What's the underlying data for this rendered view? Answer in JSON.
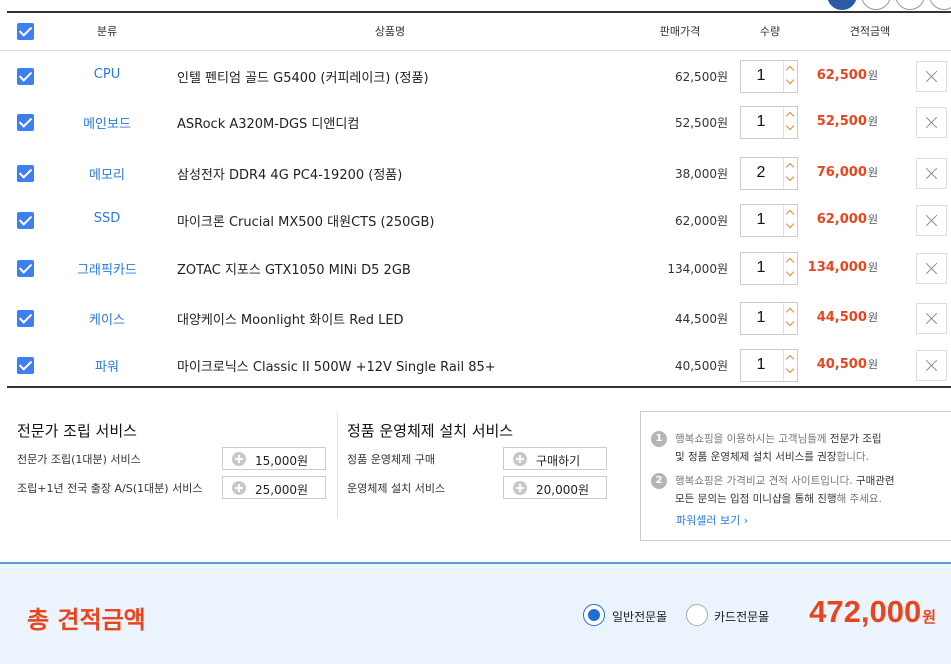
{
  "header": {
    "category": "분류",
    "product": "상품명",
    "price": "판매가격",
    "quantity": "수량",
    "estimate": "견적금액"
  },
  "items": [
    {
      "category": "CPU",
      "product": "인텔 펜티엄 골드 G5400 (커피레이크) (정품)",
      "price": "62,500원",
      "qty": "1",
      "total": "62,500",
      "won": "원"
    },
    {
      "category": "메인보드",
      "product": "ASRock A320M-DGS 디앤디컴",
      "price": "52,500원",
      "qty": "1",
      "total": "52,500",
      "won": "원"
    },
    {
      "category": "메모리",
      "product": "삼성전자 DDR4 4G PC4-19200 (정품)",
      "price": "38,000원",
      "qty": "2",
      "total": "76,000",
      "won": "원"
    },
    {
      "category": "SSD",
      "product": "마이크론 Crucial MX500 대원CTS (250GB)",
      "price": "62,000원",
      "qty": "1",
      "total": "62,000",
      "won": "원"
    },
    {
      "category": "그래픽카드",
      "product": "ZOTAC 지포스 GTX1050 MINi D5 2GB",
      "price": "134,000원",
      "qty": "1",
      "total": "134,000",
      "won": "원"
    },
    {
      "category": "케이스",
      "product": "대양케이스 Moonlight 화이트 Red LED",
      "price": "44,500원",
      "qty": "1",
      "total": "44,500",
      "won": "원"
    },
    {
      "category": "파워",
      "product": "마이크로닉스 Classic II 500W +12V Single Rail 85+",
      "price": "40,500원",
      "qty": "1",
      "total": "40,500",
      "won": "원"
    }
  ],
  "assembly": {
    "title": "전문가 조립 서비스",
    "opt1_label": "전문가 조립(1대분) 서비스",
    "opt1_btn": "15,000원",
    "opt2_label": "조립+1년 전국 출장 A/S(1대분) 서비스",
    "opt2_btn": "25,000원"
  },
  "os": {
    "title": "정품 운영체제 설치 서비스",
    "opt1_label": "정품 운영체제 구매",
    "opt1_btn": "구매하기",
    "opt2_label": "운영체제 설치 서비스",
    "opt2_btn": "20,000원"
  },
  "info": {
    "n1": "1",
    "n2": "2",
    "note1_a": "행복쇼핑을 이용하시는 고객님들께 ",
    "note1_b": "전문가 조립",
    "note1_c": "및 정품 운영체제 설치 서비스를 권장",
    "note1_d": "합니다.",
    "note2_a": "행복쇼핑은 가격비교 견적 사이트입니다. ",
    "note2_b": "구매관련",
    "note2_c": "모든 문의는 입점 미니샵을 통해 진행",
    "note2_d": "해 주세요.",
    "link": "파워셀러 보기 ›"
  },
  "footer": {
    "title": "총 견적금액",
    "radio1": "일반전문몰",
    "radio2": "카드전문몰",
    "selected": "일반전문몰",
    "total": "472,000",
    "won": "원"
  },
  "colors": {
    "accent": "#3d7ef0",
    "category": "#2a7ae2",
    "price_red": "#e8451f",
    "footer_bg": "#ebf3fc"
  },
  "icons": {
    "checkbox": "checkbox-checked-icon",
    "delete": "close-icon",
    "plus": "plus-circle-icon",
    "spinner": "chevron-updown-icon"
  }
}
